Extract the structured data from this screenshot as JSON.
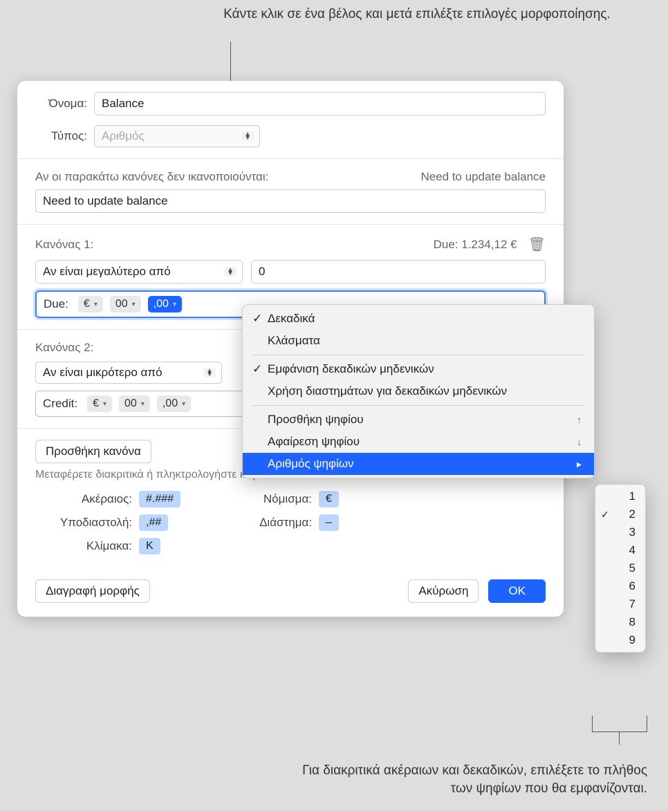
{
  "callouts": {
    "top": "Κάντε κλικ σε ένα βέλος και μετά επιλέξτε επιλογές μορφοποίησης.",
    "bottom": "Για διακριτικά ακέραιων και δεκαδικών, επιλέξετε το πλήθος των ψηφίων που θα εμφανίζονται."
  },
  "labels": {
    "name": "Όνομα:",
    "type": "Τύπος:",
    "fallback": "Αν οι παρακάτω κανόνες δεν ικανοποιούνται:",
    "rule1": "Κανόνας 1:",
    "rule2": "Κανόνας 2:",
    "add_rule": "Προσθήκη κανόνα",
    "drag_help": "Μεταφέρετε διακριτικά ή πληκτρολογήστε κείμενο στο πεδίο από πάνω:",
    "integer": "Ακέραιος:",
    "decimal": "Υποδιαστολή:",
    "scale": "Κλίμακα:",
    "currency": "Νόμισμα:",
    "space": "Διάστημα:",
    "delete_format": "Διαγραφή μορφής",
    "cancel": "Ακύρωση",
    "ok": "OK"
  },
  "values": {
    "name": "Balance",
    "type": "Αριθμός",
    "fallback_preview": "Need to update balance",
    "fallback_value": "Need to update balance",
    "rule1_preview": "Due: 1.234,12 €",
    "rule1_condition": "Αν είναι μεγαλύτερο από",
    "rule1_value": "0",
    "rule1_prefix": "Due:",
    "rule2_condition": "Αν είναι μικρότερο από",
    "rule2_prefix": "Credit:",
    "chips": {
      "currency": "€",
      "int": "00",
      "dec": ",00"
    }
  },
  "tokens": {
    "integer": "#.###",
    "decimal": ",##",
    "scale": "K",
    "currency": "€",
    "space": "–"
  },
  "popover": {
    "decimals": "Δεκαδικά",
    "fractions": "Κλάσματα",
    "show_zeros": "Εμφάνιση δεκαδικών μηδενικών",
    "use_spaces": "Χρήση διαστημάτων για δεκαδικών μηδενικών",
    "add_digit": "Προσθήκη ψηφίου",
    "remove_digit": "Αφαίρεση ψηφίου",
    "digit_count": "Αριθμός ψηφίων"
  },
  "submenu": {
    "options": [
      "1",
      "2",
      "3",
      "4",
      "5",
      "6",
      "7",
      "8",
      "9"
    ],
    "selected_index": 1
  }
}
